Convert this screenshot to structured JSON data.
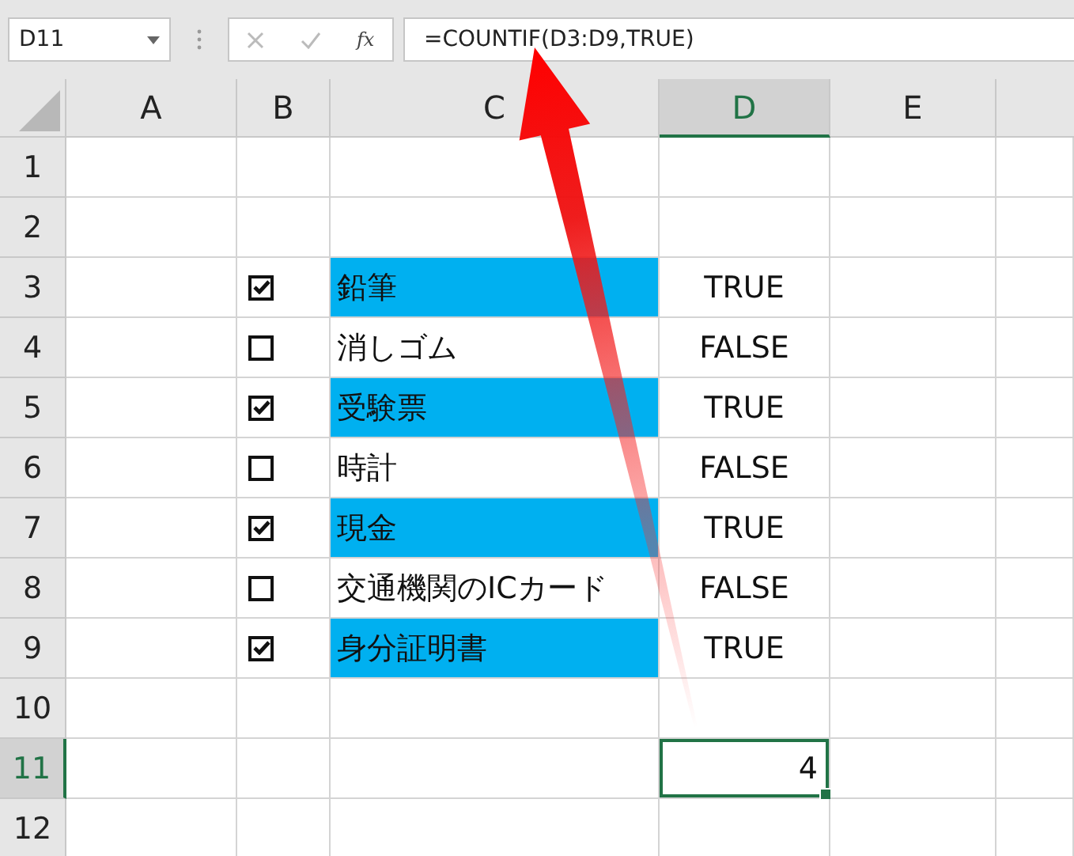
{
  "name_box": {
    "value": "D11"
  },
  "formula_bar": {
    "function_label": "fx",
    "formula": "=COUNTIF(D3:D9,TRUE)"
  },
  "columns": [
    {
      "label": "A",
      "selected": false
    },
    {
      "label": "B",
      "selected": false
    },
    {
      "label": "C",
      "selected": false
    },
    {
      "label": "D",
      "selected": true
    },
    {
      "label": "E",
      "selected": false
    }
  ],
  "rows": [
    {
      "label": "1",
      "selected": false
    },
    {
      "label": "2",
      "selected": false
    },
    {
      "label": "3",
      "selected": false,
      "checkbox": {
        "checked": true
      },
      "item": {
        "text": "鉛筆",
        "highlighted": true
      },
      "value": {
        "text": "TRUE",
        "kind": "boolean"
      }
    },
    {
      "label": "4",
      "selected": false,
      "checkbox": {
        "checked": false
      },
      "item": {
        "text": "消しゴム",
        "highlighted": false
      },
      "value": {
        "text": "FALSE",
        "kind": "boolean"
      }
    },
    {
      "label": "5",
      "selected": false,
      "checkbox": {
        "checked": true
      },
      "item": {
        "text": "受験票",
        "highlighted": true
      },
      "value": {
        "text": "TRUE",
        "kind": "boolean"
      }
    },
    {
      "label": "6",
      "selected": false,
      "checkbox": {
        "checked": false
      },
      "item": {
        "text": "時計",
        "highlighted": false
      },
      "value": {
        "text": "FALSE",
        "kind": "boolean"
      }
    },
    {
      "label": "7",
      "selected": false,
      "checkbox": {
        "checked": true
      },
      "item": {
        "text": "現金",
        "highlighted": true
      },
      "value": {
        "text": "TRUE",
        "kind": "boolean"
      }
    },
    {
      "label": "8",
      "selected": false,
      "checkbox": {
        "checked": false
      },
      "item": {
        "text": "交通機関のICカード",
        "highlighted": false
      },
      "value": {
        "text": "FALSE",
        "kind": "boolean"
      }
    },
    {
      "label": "9",
      "selected": false,
      "checkbox": {
        "checked": true
      },
      "item": {
        "text": "身分証明書",
        "highlighted": true
      },
      "value": {
        "text": "TRUE",
        "kind": "boolean"
      }
    },
    {
      "label": "10",
      "selected": false
    },
    {
      "label": "11",
      "selected": true,
      "value": {
        "text": "4",
        "kind": "number",
        "selected": true
      }
    },
    {
      "label": "12",
      "selected": false
    }
  ]
}
